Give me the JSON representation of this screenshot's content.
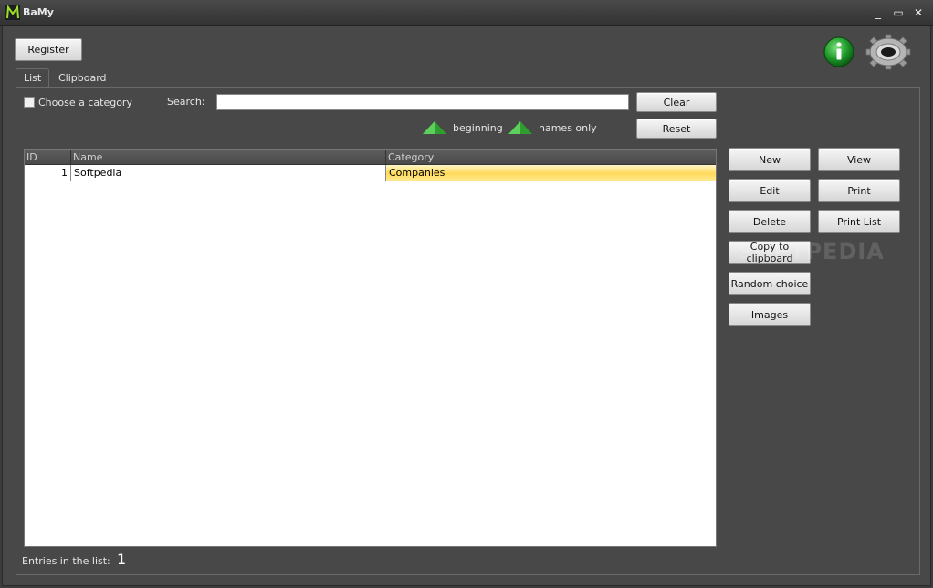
{
  "window": {
    "title": "BaMy",
    "minimize_glyph": "_",
    "maximize_glyph": "▭",
    "close_glyph": "✕"
  },
  "toolbar": {
    "register_label": "Register",
    "info_icon": "info-icon",
    "settings_icon": "gear-icon"
  },
  "tabs": [
    {
      "label": "List",
      "active": true
    },
    {
      "label": "Clipboard",
      "active": false
    }
  ],
  "filter": {
    "category_label": "Choose a category",
    "search_label": "Search:",
    "search_value": "",
    "clear_label": "Clear",
    "reset_label": "Reset",
    "beginning_label": "beginning",
    "names_only_label": "names only"
  },
  "table": {
    "columns": [
      "ID",
      "Name",
      "Category"
    ],
    "rows": [
      {
        "id": "1",
        "name": "Softpedia",
        "category": "Companies"
      }
    ]
  },
  "actions": {
    "new": "New",
    "view": "View",
    "edit": "Edit",
    "print": "Print",
    "delete": "Delete",
    "print_list": "Print List",
    "copy_to_clipboard": "Copy to clipboard",
    "random_choice": "Random choice",
    "images": "Images"
  },
  "footer": {
    "entries_label": "Entries in the list:",
    "entries_count": "1"
  },
  "watermark": "SOFTPEDIA",
  "colors": {
    "accent_green": "#2e9e2e",
    "selection": "#ffd95a"
  }
}
